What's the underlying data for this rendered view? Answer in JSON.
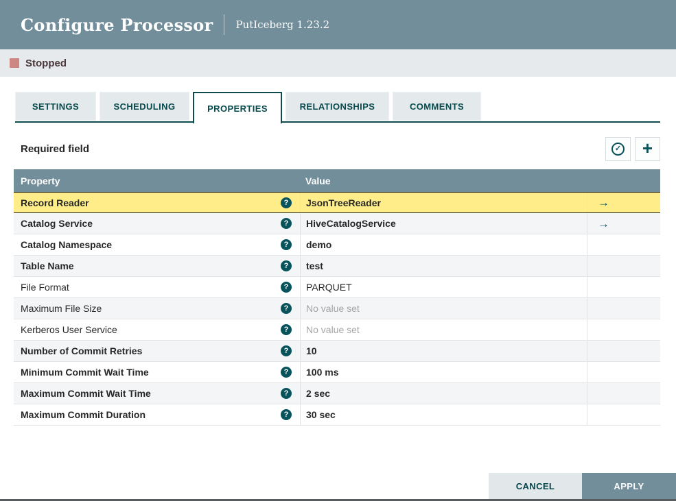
{
  "dialog": {
    "title": "Configure Processor",
    "subtitle": "PutIceberg 1.23.2"
  },
  "status": {
    "label": "Stopped",
    "square_color": "#CE8683"
  },
  "tabs": [
    {
      "label": "SETTINGS",
      "active": false
    },
    {
      "label": "SCHEDULING",
      "active": false
    },
    {
      "label": "PROPERTIES",
      "active": true
    },
    {
      "label": "RELATIONSHIPS",
      "active": false
    },
    {
      "label": "COMMENTS",
      "active": false
    }
  ],
  "panel": {
    "required_hint": "Required field",
    "verify_icon": "check-circle-icon",
    "add_icon": "plus-icon"
  },
  "table": {
    "columns": [
      "Property",
      "Value"
    ],
    "rows": [
      {
        "property": "Record Reader",
        "value": "JsonTreeReader",
        "required": true,
        "value_set": true,
        "has_goto": true,
        "selected": true
      },
      {
        "property": "Catalog Service",
        "value": "HiveCatalogService",
        "required": true,
        "value_set": true,
        "has_goto": true,
        "selected": false
      },
      {
        "property": "Catalog Namespace",
        "value": "demo",
        "required": true,
        "value_set": true,
        "has_goto": false,
        "selected": false
      },
      {
        "property": "Table Name",
        "value": "test",
        "required": true,
        "value_set": true,
        "has_goto": false,
        "selected": false
      },
      {
        "property": "File Format",
        "value": "PARQUET",
        "required": false,
        "value_set": true,
        "has_goto": false,
        "selected": false
      },
      {
        "property": "Maximum File Size",
        "value": "No value set",
        "required": false,
        "value_set": false,
        "has_goto": false,
        "selected": false
      },
      {
        "property": "Kerberos User Service",
        "value": "No value set",
        "required": false,
        "value_set": false,
        "has_goto": false,
        "selected": false
      },
      {
        "property": "Number of Commit Retries",
        "value": "10",
        "required": true,
        "value_set": true,
        "has_goto": false,
        "selected": false
      },
      {
        "property": "Minimum Commit Wait Time",
        "value": "100 ms",
        "required": true,
        "value_set": true,
        "has_goto": false,
        "selected": false
      },
      {
        "property": "Maximum Commit Wait Time",
        "value": "2 sec",
        "required": true,
        "value_set": true,
        "has_goto": false,
        "selected": false
      },
      {
        "property": "Maximum Commit Duration",
        "value": "30 sec",
        "required": true,
        "value_set": true,
        "has_goto": false,
        "selected": false
      }
    ]
  },
  "footer": {
    "cancel_label": "CANCEL",
    "apply_label": "APPLY"
  },
  "colors": {
    "header_bg": "#728E9B",
    "accent_teal": "#07535C",
    "tab_text": "#074A4D",
    "selected_row_bg": "#FFED8A",
    "status_bar_bg": "#E7EAEC",
    "apply_button_bg": "#728E9B",
    "cancel_button_bg": "#E2E7EA"
  }
}
